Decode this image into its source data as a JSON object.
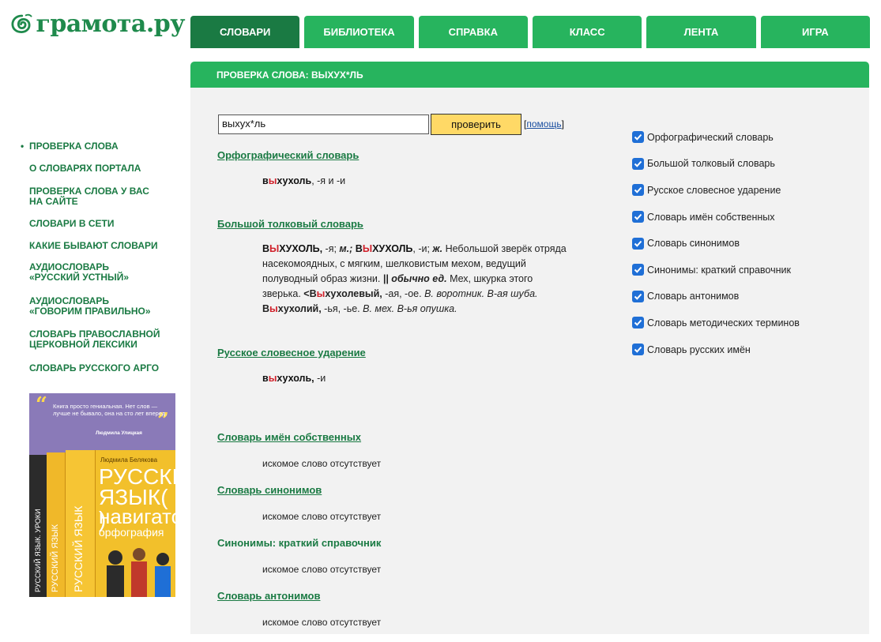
{
  "logo": {
    "text": "грамота.ру"
  },
  "topnav": {
    "tabs": [
      {
        "label": "СЛОВАРИ",
        "active": true
      },
      {
        "label": "БИБЛИОТЕКА",
        "active": false
      },
      {
        "label": "СПРАВКА",
        "active": false
      },
      {
        "label": "КЛАСС",
        "active": false
      },
      {
        "label": "ЛЕНТА",
        "active": false
      },
      {
        "label": "ИГРА",
        "active": false
      }
    ]
  },
  "titlebar": {
    "title": "ПРОВЕРКА СЛОВА: ВЫХУХ*ЛЬ"
  },
  "sidebar": {
    "items": [
      {
        "label": "ПРОВЕРКА СЛОВА",
        "bullet": "•"
      },
      {
        "label": "О СЛОВАРЯХ ПОРТАЛА"
      },
      {
        "line1": "ПРОВЕРКА СЛОВА У ВАС",
        "line2": "НА САЙТЕ"
      },
      {
        "label": "СЛОВАРИ В СЕТИ"
      },
      {
        "label": "КАКИЕ БЫВАЮТ СЛОВАРИ"
      },
      {
        "line1": "АУДИОСЛОВАРЬ",
        "line2": "«РУССКИЙ УСТНЫЙ»"
      },
      {
        "line1": "АУДИОСЛОВАРЬ",
        "line2": "«ГОВОРИМ ПРАВИЛЬНО»"
      },
      {
        "line1": "СЛОВАРЬ ПРАВОСЛАВНОЙ",
        "line2": "ЦЕРКОВНОЙ ЛЕКСИКИ"
      },
      {
        "label": "СЛОВАРЬ РУССКОГО АРГО"
      }
    ]
  },
  "book_ad": {
    "quote_open": "“",
    "quote_close": "”",
    "quote": "Книга просто гениальная. Нет слов — лучше не бывало, она на сто лет вперед.",
    "quote_author": "Людмила Улицкая",
    "cover_author": "Людмила Белякова",
    "cover_t1": "РУССКИЙ",
    "cover_t2": "ЯЗЫК( )",
    "cover_t3": "навигатор",
    "cover_t4": "орфография",
    "spine1": "РУССКИЙ ЯЗЫК. УРОКИ",
    "spine2": "РУССКИЙ ЯЗЫК",
    "spine3": "РУССКИЙ ЯЗЫК"
  },
  "search": {
    "value": "выхух*ль",
    "button": "проверить",
    "help_open": "[",
    "help": "помощь",
    "help_close": "]"
  },
  "results": {
    "orfo": {
      "title": "Орфографический словарь",
      "hw_pre": "в",
      "hw_acc": "ы",
      "hw_post": "хухоль",
      "rest": ", -я и -и"
    },
    "btsl": {
      "title": "Большой толковый словарь",
      "l1_hw1a": "В",
      "l1_hw1acc": "Ы",
      "l1_hw1b": "ХУХОЛЬ,",
      "l1_t1": " -я; ",
      "l1_m": "м.;",
      "l1_sp": " ",
      "l1_hw2a": "В",
      "l1_hw2acc": "Ы",
      "l1_hw2b": "ХУХОЛЬ",
      "l1_t2": ", -и; ",
      "l1_zh": "ж.",
      "l1_t3": " Небольшой зверёк отряда",
      "l2": "насекомоядных, с мягким, шелковистым мехом, ведущий",
      "l3_a": "полуводный образ жизни. ",
      "l3_b": "||",
      "l3_sp": " ",
      "l3_c": "обычно ед.",
      "l3_d": " Мех, шкурка этого",
      "l4_a": "зверька. ",
      "l4_b": "<В",
      "l4_acc": "ы",
      "l4_c": "хухолевый,",
      "l4_d": " -ая, -ое. ",
      "l4_e": "В. воротник. В-ая шуба.",
      "l5_a": "В",
      "l5_acc": "ы",
      "l5_b": "хухолий,",
      "l5_c": " -ья, -ье. ",
      "l5_d": "В. мех. В-ья опушка."
    },
    "stress": {
      "title": "Русское словесное ударение",
      "hw_pre": "в",
      "hw_acc": "ы",
      "hw_post": "хухоль,",
      "rest": " -и"
    },
    "proper": {
      "title": "Словарь имён собственных",
      "note": "искомое слово отсутствует"
    },
    "syn": {
      "title": "Словарь синонимов",
      "note": "искомое слово отсутствует"
    },
    "syn_short": {
      "title": "Синонимы: краткий справочник",
      "note": "искомое слово отсутствует"
    },
    "ant": {
      "title": "Словарь антонимов",
      "note": "искомое слово отсутствует"
    }
  },
  "dictionaries": [
    {
      "label": "Орфографический словарь",
      "checked": true
    },
    {
      "label": "Большой толковый словарь",
      "checked": true
    },
    {
      "label": "Русское словесное ударение",
      "checked": true
    },
    {
      "label": "Словарь имён собственных",
      "checked": true
    },
    {
      "label": "Словарь синонимов",
      "checked": true
    },
    {
      "label": "Синонимы: краткий справочник",
      "checked": true
    },
    {
      "label": "Словарь антонимов",
      "checked": true
    },
    {
      "label": "Словарь методических терминов",
      "checked": true
    },
    {
      "label": "Словарь русских имён",
      "checked": true
    }
  ],
  "colors": {
    "brand_green": "#27b45e",
    "dark_green": "#1a7a43",
    "accent_red": "#d0202a",
    "button_yellow": "#ffd966",
    "checkbox_blue": "#1f6fd6"
  }
}
